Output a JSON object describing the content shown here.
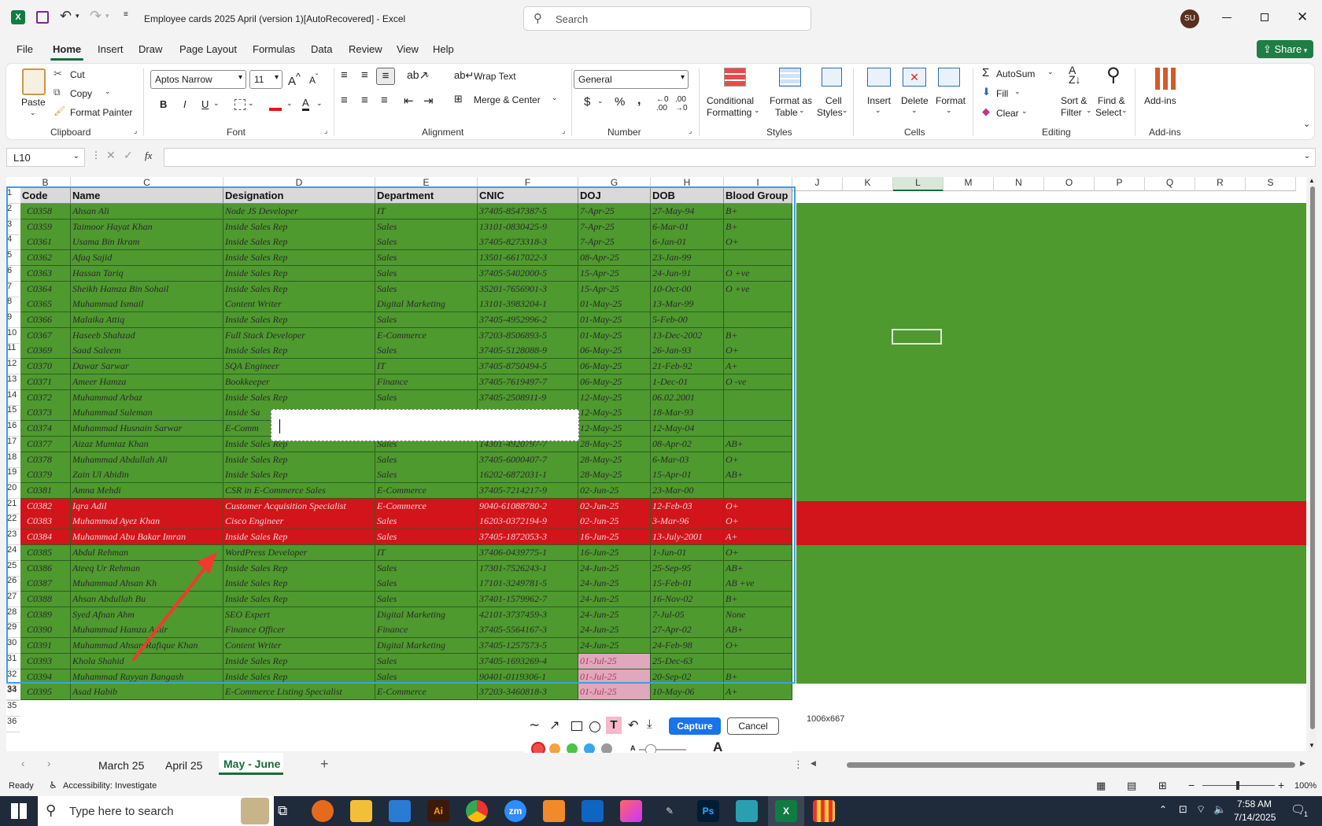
{
  "window": {
    "title": "Employee cards 2025 April (version 1)[AutoRecovered]  -  Excel",
    "search_placeholder": "Search",
    "user_initials": "SU",
    "share_label": "Share"
  },
  "menu": [
    "File",
    "Home",
    "Insert",
    "Draw",
    "Page Layout",
    "Formulas",
    "Data",
    "Review",
    "View",
    "Help"
  ],
  "ribbon": {
    "clipboard": {
      "paste": "Paste",
      "cut": "Cut",
      "copy": "Copy",
      "format_painter": "Format Painter",
      "label": "Clipboard"
    },
    "font": {
      "name": "Aptos Narrow",
      "size": "11",
      "label": "Font",
      "bold": "B",
      "italic": "I",
      "underline": "U"
    },
    "alignment": {
      "wrap": "Wrap Text",
      "merge": "Merge & Center",
      "label": "Alignment"
    },
    "number": {
      "format": "General",
      "label": "Number"
    },
    "styles": {
      "cond1": "Conditional",
      "cond2": "Formatting",
      "fmt1": "Format as",
      "fmt2": "Table",
      "cell1": "Cell",
      "cell2": "Styles",
      "label": "Styles"
    },
    "cells": {
      "insert": "Insert",
      "delete": "Delete",
      "format": "Format",
      "label": "Cells"
    },
    "editing": {
      "autosum": "AutoSum",
      "fill": "Fill",
      "clear": "Clear",
      "sort1": "Sort &",
      "sort2": "Filter",
      "find1": "Find &",
      "find2": "Select",
      "label": "Editing"
    },
    "addins": {
      "btn": "Add-ins",
      "label": "Add-ins"
    }
  },
  "formula": {
    "name_box": "L10",
    "fx": "fx"
  },
  "columns": [
    "B",
    "C",
    "D",
    "E",
    "F",
    "G",
    "H",
    "I",
    "J",
    "K",
    "L",
    "M",
    "N",
    "O",
    "P",
    "Q",
    "R",
    "S"
  ],
  "headers": [
    "Code",
    "Name",
    "Designation",
    "Department",
    "CNIC",
    "DOJ",
    "DOB",
    "Blood Group"
  ],
  "rows": [
    [
      "C0358",
      "Ahsan Ali",
      "Node JS Developer",
      "IT",
      "37405-8547387-5",
      "7-Apr-25",
      "27-May-94",
      "B+"
    ],
    [
      "C0359",
      "Taimoor Hayat Khan",
      "Inside Sales Rep",
      "Sales",
      "13101-0830425-9",
      "7-Apr-25",
      "6-Mar-01",
      "B+"
    ],
    [
      "C0361",
      "Usama Bin Ikram",
      "Inside Sales Rep",
      "Sales",
      "37405-8273318-3",
      "7-Apr-25",
      "6-Jan-01",
      "O+"
    ],
    [
      "C0362",
      "Afaq Sajid",
      "Inside Sales Rep",
      "Sales",
      "13501-6617022-3",
      "08-Apr-25",
      "23-Jan-99",
      ""
    ],
    [
      "C0363",
      "Hassan Tariq",
      "Inside Sales Rep",
      "Sales",
      "37405-5402000-5",
      "15-Apr-25",
      "24-Jun-91",
      "O +ve"
    ],
    [
      "C0364",
      "Sheikh Hamza Bin Sohail",
      "Inside Sales Rep",
      "Sales",
      "35201-7656901-3",
      "15-Apr-25",
      "10-Oct-00",
      "O +ve"
    ],
    [
      "C0365",
      "Muhammad Ismail",
      "Content Writer",
      "Digital Marketing",
      "13101-3983204-1",
      "01-May-25",
      "13-Mar-99",
      ""
    ],
    [
      "C0366",
      "Malaika Attiq",
      "Inside Sales Rep",
      "Sales",
      "37405-4952996-2",
      "01-May-25",
      "5-Feb-00",
      ""
    ],
    [
      "C0367",
      "Haseeb Shahzad",
      "Full Stack Developer",
      "E-Commerce",
      "37203-8506893-5",
      "01-May-25",
      "13-Dec-2002",
      "B+"
    ],
    [
      "C0369",
      "Saad Saleem",
      "Inside Sales Rep",
      "Sales",
      "37405-5128088-9",
      "06-May-25",
      "26-Jan-93",
      "O+"
    ],
    [
      "C0370",
      "Dawar Sarwar",
      "SQA Engineer",
      "IT",
      "37405-8750494-5",
      "06-May-25",
      "21-Feb-92",
      "A+"
    ],
    [
      "C0371",
      "Ameer Hamza",
      "Bookkeeper",
      "Finance",
      "37405-7619497-7",
      "06-May-25",
      "1-Dec-01",
      "O -ve"
    ],
    [
      "C0372",
      "Muhammad Arbaz",
      "Inside Sales Rep",
      "Sales",
      "37405-2508911-9",
      "12-May-25",
      "06.02.2001",
      ""
    ],
    [
      "C0373",
      "Muhammad Suleman",
      "Inside Sa",
      "",
      "",
      "12-May-25",
      "18-Mar-93",
      ""
    ],
    [
      "C0374",
      "Muhammad Husnain Sarwar",
      "E-Comm",
      "",
      "",
      "12-May-25",
      "12-May-04",
      ""
    ],
    [
      "C0377",
      "Aizaz Mumtaz Khan",
      "Inside Sales Rep",
      "Sales",
      "14301-4920797-7",
      "28-May-25",
      "08-Apr-02",
      "AB+"
    ],
    [
      "C0378",
      "Muhammad Abdullah Ali",
      "Inside Sales Rep",
      "Sales",
      "37405-6000407-7",
      "28-May-25",
      "6-Mar-03",
      "O+"
    ],
    [
      "C0379",
      "Zain Ul Abidin",
      "Inside Sales Rep",
      "Sales",
      "16202-6872031-1",
      "28-May-25",
      "15-Apr-01",
      "AB+"
    ],
    [
      "C0381",
      "Amna Mehdi",
      "CSR in E-Commerce Sales",
      "E-Commerce",
      "37405-7214217-9",
      "02-Jun-25",
      "23-Mar-00",
      ""
    ],
    [
      "C0382",
      "Iqra Adil",
      "Customer Acquisition Specialist",
      "E-Commerce",
      "9040-61088780-2",
      "02-Jun-25",
      "12-Feb-03",
      "O+"
    ],
    [
      "C0383",
      "Muhammad Ayez Khan",
      "Cisco Engineer",
      "Sales",
      "16203-0372194-9",
      "02-Jun-25",
      "3-Mar-96",
      "O+"
    ],
    [
      "C0384",
      "Muhammad Abu Bakar Imran",
      "Inside Sales Rep",
      "Sales",
      "37405-1872053-3",
      "16-Jun-25",
      "13-July-2001",
      "A+"
    ],
    [
      "C0385",
      "Abdul Rehman",
      "WordPress Developer",
      "IT",
      "37406-0439775-1",
      "16-Jun-25",
      "1-Jun-01",
      "O+"
    ],
    [
      "C0386",
      "Ateeq Ur Rehman",
      "Inside Sales Rep",
      "Sales",
      "17301-7526243-1",
      "24-Jun-25",
      "25-Sep-95",
      "AB+"
    ],
    [
      "C0387",
      "Muhammad Ahsan Kh",
      "Inside Sales Rep",
      "Sales",
      "17101-3249781-5",
      "24-Jun-25",
      "15-Feb-01",
      "AB +ve"
    ],
    [
      "C0388",
      "Ahsan Abdullah Bu",
      "Inside Sales Rep",
      "Sales",
      "37401-1579962-7",
      "24-Jun-25",
      "16-Nov-02",
      "B+"
    ],
    [
      "C0389",
      "Syed Afnan Ahm",
      "SEO Expert",
      "Digital Marketing",
      "42101-3737459-3",
      "24-Jun-25",
      "7-Jul-05",
      "None"
    ],
    [
      "C0390",
      "Muhammad Hamza Amir",
      "Finance Officer",
      "Finance",
      "37405-5564167-3",
      "24-Jun-25",
      "27-Apr-02",
      "AB+"
    ],
    [
      "C0391",
      "Muhammad Ahsan Rafique Khan",
      "Content Writer",
      "Digital Marketing",
      "37405-1257573-5",
      "24-Jun-25",
      "24-Feb-98",
      "O+"
    ],
    [
      "C0393",
      "Khola Shahid",
      "Inside Sales Rep",
      "Sales",
      "37405-1693269-4",
      "01-Jul-25",
      "25-Dec-63",
      ""
    ],
    [
      "C0394",
      "Muhammad Rayyan Bangash",
      "Inside Sales Rep",
      "Sales",
      "90401-0119306-1",
      "01-Jul-25",
      "20-Sep-02",
      "B+"
    ],
    [
      "C0395",
      "Asad Habib",
      "E-Commerce Listing Specialist",
      "E-Commerce",
      "37203-3460818-3",
      "01-Jul-25",
      "10-May-06",
      "A+"
    ]
  ],
  "extra_rows": [
    "34",
    "35",
    "36"
  ],
  "capture": {
    "size": "1006x667",
    "capture_label": "Capture",
    "cancel_label": "Cancel",
    "a_small": "A",
    "a_big": "A"
  },
  "sheets": [
    "March 25",
    "April 25",
    "May - June"
  ],
  "status": {
    "ready": "Ready",
    "accessibility": "Accessibility: Investigate",
    "zoom": "100%"
  },
  "taskbar": {
    "search_placeholder": "Type here to search",
    "time": "7:58 AM",
    "date": "7/14/2025",
    "notif": "1"
  },
  "colors": {
    "green_fill": "#4e9a2e",
    "red_fill": "#d2141b",
    "header_fill": "#d9d9d9",
    "pink_fill": "#dfa8bd",
    "accent": "#166c3b"
  }
}
